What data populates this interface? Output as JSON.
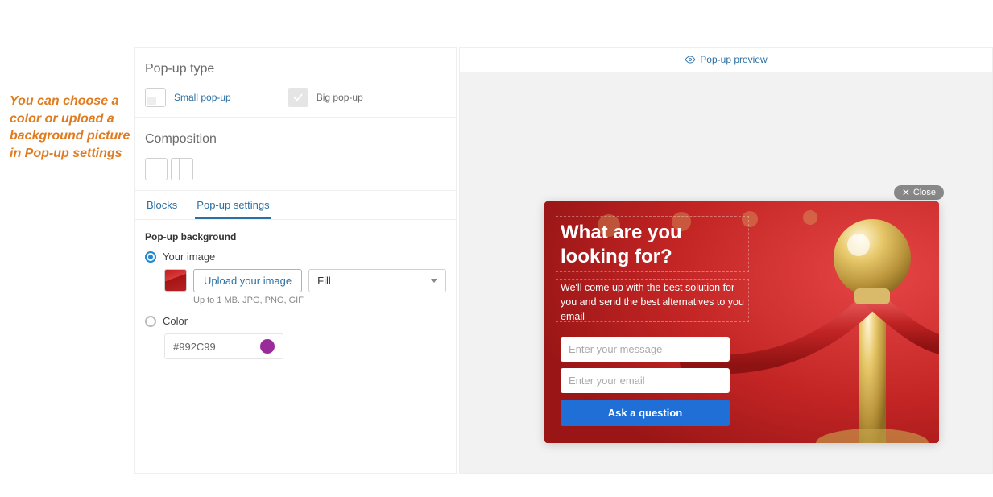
{
  "annotation": {
    "text": "You can choose a color or upload a background picture in Pop-up settings"
  },
  "settings": {
    "popup_type": {
      "title": "Pop-up type",
      "small_label": "Small pop-up",
      "big_label": "Big pop-up",
      "selected": "big"
    },
    "composition": {
      "title": "Composition"
    },
    "tabs": {
      "blocks": "Blocks",
      "popup_settings": "Pop-up settings",
      "active": "popup_settings"
    },
    "popup_background": {
      "heading": "Pop-up background",
      "image_option": {
        "label": "Your image",
        "upload_button": "Upload your image",
        "fill_mode": "Fill",
        "hint": "Up to 1 MB. JPG, PNG, GIF",
        "selected": true
      },
      "color_option": {
        "label": "Color",
        "hex": "#992C99",
        "selected": false
      }
    }
  },
  "preview": {
    "header_label": "Pop-up preview",
    "close_label": "Close",
    "popup": {
      "heading": "What are you looking for?",
      "subtext": "We'll come up with the best solution for you and send the best alternatives to you email",
      "message_placeholder": "Enter your message",
      "email_placeholder": "Enter your email",
      "button_label": "Ask a question"
    }
  },
  "colors": {
    "swatch": "#992C99"
  }
}
